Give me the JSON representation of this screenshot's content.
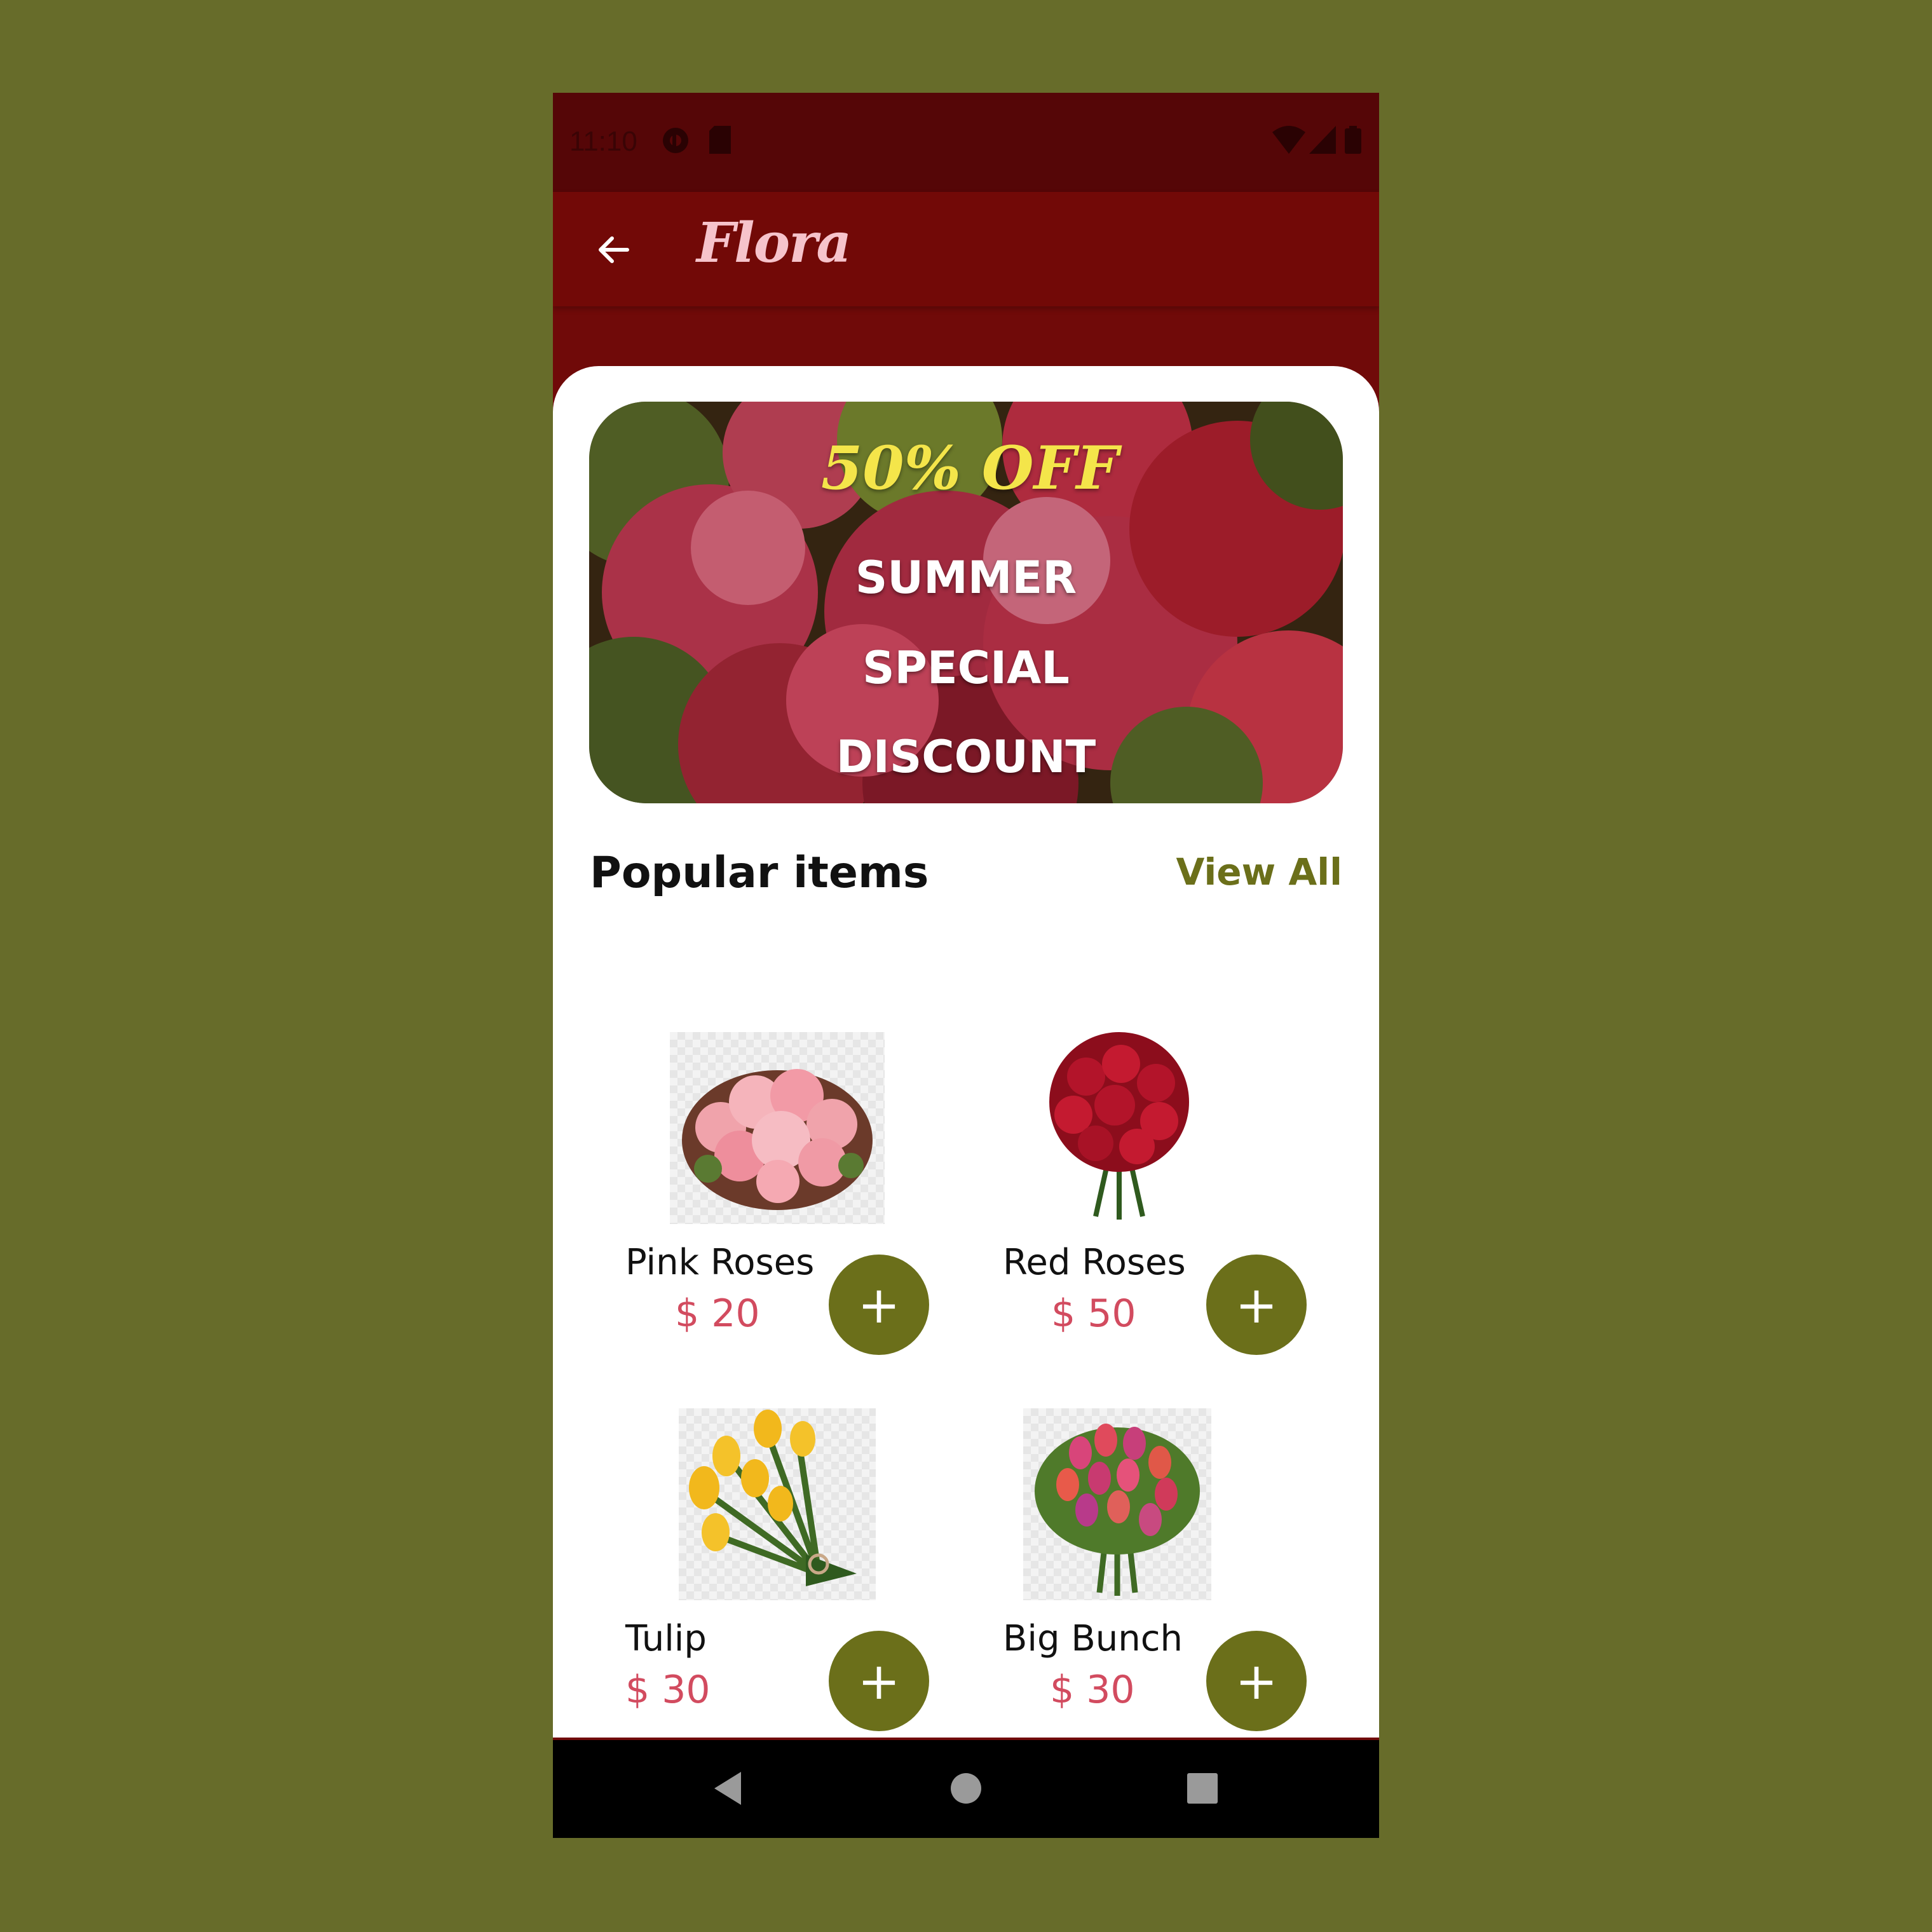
{
  "status_bar": {
    "time": "11:10"
  },
  "app_bar": {
    "title": "Flora"
  },
  "banner": {
    "offer": "50% OFF",
    "line1": "SUMMER",
    "line2": "SPECIAL",
    "line3": "DISCOUNT"
  },
  "section": {
    "title": "Popular items",
    "view_all": "View All"
  },
  "items": [
    {
      "name": "Pink Roses",
      "price": "$ 20",
      "add": "+"
    },
    {
      "name": "Red Roses",
      "price": "$ 50",
      "add": "+"
    },
    {
      "name": "Tulip",
      "price": "$ 30",
      "add": "+"
    },
    {
      "name": "Big Bunch",
      "price": "$ 30",
      "add": "+"
    }
  ],
  "colors": {
    "background": "#676c2a",
    "primary_dark": "#550607",
    "primary": "#720907",
    "accent": "#6b6f1a",
    "price": "#d24b5f",
    "offer": "#f4e54a",
    "title": "#f6c3cb"
  },
  "icons": {
    "back": "arrow-left-icon",
    "add": "plus-icon",
    "nav_back": "triangle-back-icon",
    "nav_home": "circle-home-icon",
    "nav_recents": "square-recents-icon"
  }
}
